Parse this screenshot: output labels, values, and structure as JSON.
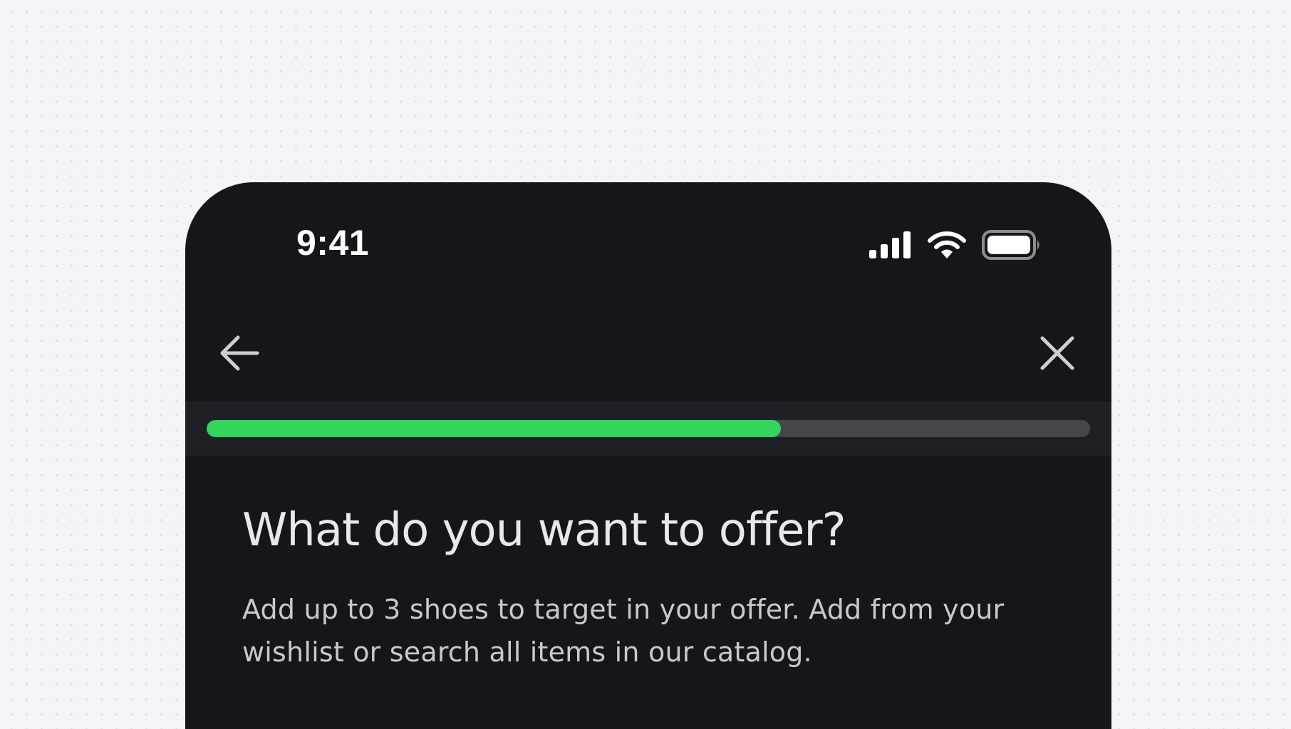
{
  "status_bar": {
    "time": "9:41",
    "icons": [
      "cellular-signal-icon",
      "wifi-icon",
      "battery-icon"
    ]
  },
  "toolbar": {
    "back_icon": "arrow-left-icon",
    "close_icon": "close-icon"
  },
  "progress": {
    "value_fraction": 0.65,
    "fill_color": "#32d65a",
    "track_color": "#45464c"
  },
  "content": {
    "title": "What do you want to offer?",
    "description": "Add up to 3 shoes to target in your offer. Add from your wishlist or search all items in our catalog."
  },
  "colors": {
    "page_background": "#f5f3f8",
    "app_background": "#15161a",
    "accent": "#32d65a"
  }
}
